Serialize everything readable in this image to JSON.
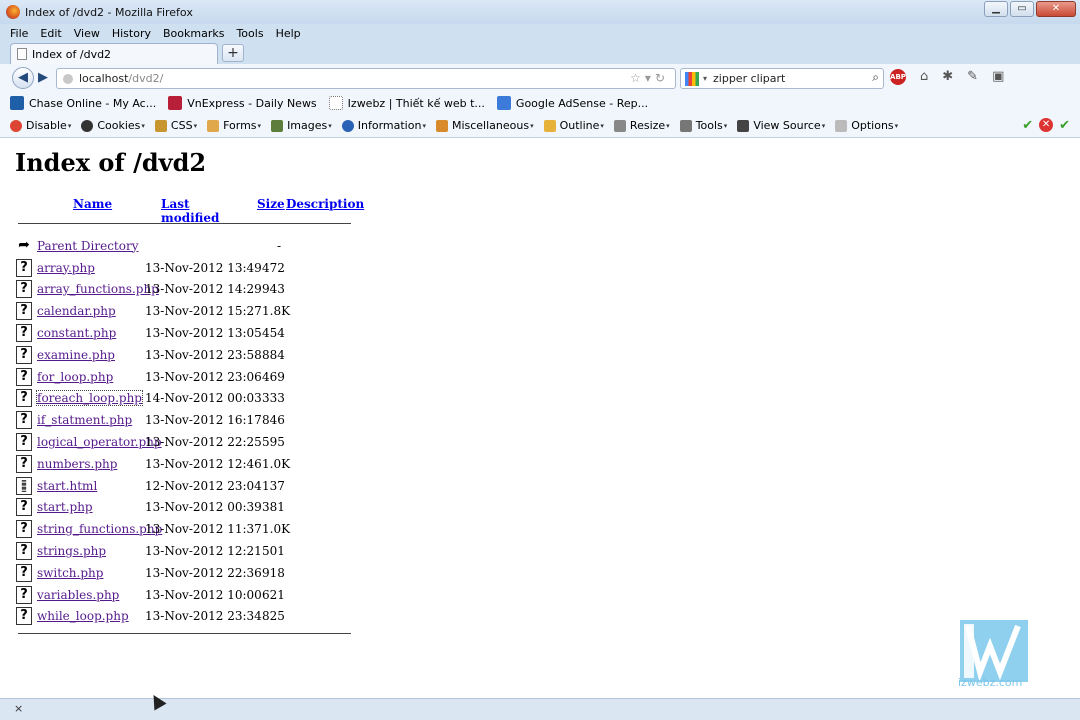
{
  "window": {
    "title": "Index of /dvd2 - Mozilla Firefox"
  },
  "menu": [
    "File",
    "Edit",
    "View",
    "History",
    "Bookmarks",
    "Tools",
    "Help"
  ],
  "tab": {
    "label": "Index of /dvd2",
    "new_tab": "+"
  },
  "address": {
    "host": "localhost",
    "path": "/dvd2/"
  },
  "search": {
    "value": "zipper clipart"
  },
  "bookmarks": [
    {
      "label": "Chase Online - My Ac...",
      "color": "#1f5fa8"
    },
    {
      "label": "VnExpress - Daily News",
      "color": "#b8203a"
    },
    {
      "label": "Izwebz | Thiết kế web t...",
      "color": "#ffffff"
    },
    {
      "label": "Google AdSense - Rep...",
      "color": "#3c7bd9"
    }
  ],
  "devtools": [
    "Disable",
    "Cookies",
    "CSS",
    "Forms",
    "Images",
    "Information",
    "Miscellaneous",
    "Outline",
    "Resize",
    "Tools",
    "View Source",
    "Options"
  ],
  "page": {
    "heading": "Index of /dvd2",
    "columns": {
      "name": "Name",
      "modified": "Last modified",
      "size": "Size",
      "description": "Description"
    },
    "parent": {
      "name": "Parent Directory",
      "size": "-"
    },
    "files": [
      {
        "name": "array.php",
        "date": "13-Nov-2012 13:49",
        "size": "472",
        "kind": "unknown"
      },
      {
        "name": "array_functions.php",
        "date": "13-Nov-2012 14:29",
        "size": "943",
        "kind": "unknown"
      },
      {
        "name": "calendar.php",
        "date": "13-Nov-2012 15:27",
        "size": "1.8K",
        "kind": "unknown"
      },
      {
        "name": "constant.php",
        "date": "13-Nov-2012 13:05",
        "size": "454",
        "kind": "unknown"
      },
      {
        "name": "examine.php",
        "date": "13-Nov-2012 23:58",
        "size": "884",
        "kind": "unknown"
      },
      {
        "name": "for_loop.php",
        "date": "13-Nov-2012 23:06",
        "size": "469",
        "kind": "unknown"
      },
      {
        "name": "foreach_loop.php",
        "date": "14-Nov-2012 00:03",
        "size": "333",
        "kind": "unknown"
      },
      {
        "name": "if_statment.php",
        "date": "13-Nov-2012 16:17",
        "size": "846",
        "kind": "unknown"
      },
      {
        "name": "logical_operator.php",
        "date": "13-Nov-2012 22:25",
        "size": "595",
        "kind": "unknown"
      },
      {
        "name": "numbers.php",
        "date": "13-Nov-2012 12:46",
        "size": "1.0K",
        "kind": "unknown"
      },
      {
        "name": "start.html",
        "date": "12-Nov-2012 23:04",
        "size": "137",
        "kind": "text"
      },
      {
        "name": "start.php",
        "date": "13-Nov-2012 00:39",
        "size": "381",
        "kind": "unknown"
      },
      {
        "name": "string_functions.php",
        "date": "13-Nov-2012 11:37",
        "size": "1.0K",
        "kind": "unknown"
      },
      {
        "name": "strings.php",
        "date": "13-Nov-2012 12:21",
        "size": "501",
        "kind": "unknown"
      },
      {
        "name": "switch.php",
        "date": "13-Nov-2012 22:36",
        "size": "918",
        "kind": "unknown"
      },
      {
        "name": "variables.php",
        "date": "13-Nov-2012 10:00",
        "size": "621",
        "kind": "unknown"
      },
      {
        "name": "while_loop.php",
        "date": "13-Nov-2012 23:34",
        "size": "825",
        "kind": "unknown"
      }
    ]
  },
  "watermark": {
    "text": "izwebz.com",
    "color": "#7cc6ea"
  },
  "statusbar": {
    "close": "×"
  }
}
